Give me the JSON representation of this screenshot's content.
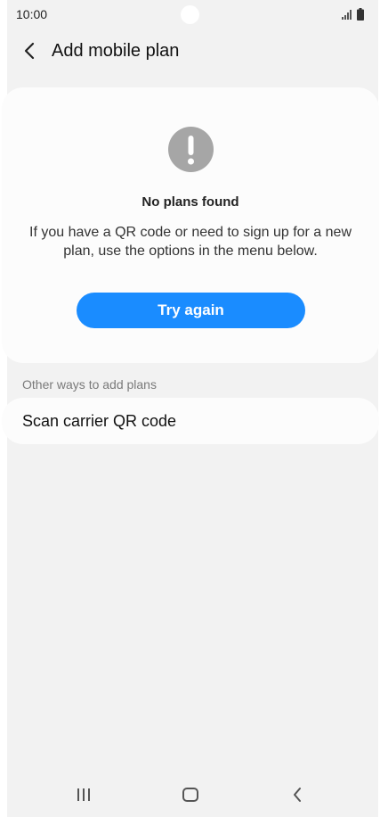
{
  "status_bar": {
    "time": "10:00"
  },
  "header": {
    "title": "Add mobile plan",
    "back_icon": "chevron-left-icon"
  },
  "card": {
    "icon": "exclamation-circle-icon",
    "heading": "No plans found",
    "message": "If you have a QR code or need to sign up for a new plan, use the options in the menu below.",
    "button_label": "Try again"
  },
  "other_ways": {
    "section_label": "Other ways to add plans",
    "items": [
      {
        "label": "Scan carrier QR code"
      }
    ]
  },
  "nav_bar": {
    "recents_icon": "recents-icon",
    "home_icon": "home-icon",
    "back_icon": "back-icon"
  },
  "colors": {
    "accent": "#1a8cff",
    "background": "#f2f2f2",
    "card": "#fcfcfc",
    "icon_gray": "#a6a6a6"
  }
}
